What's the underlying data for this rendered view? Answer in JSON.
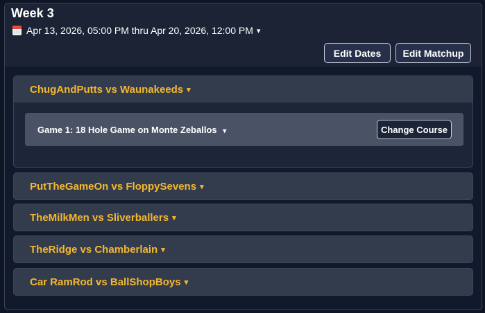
{
  "header": {
    "title": "Week 3",
    "date_range": "Apr 13, 2026, 05:00 PM thru Apr 20, 2026, 12:00 PM",
    "date_caret": "▾",
    "edit_dates_label": "Edit Dates",
    "edit_matchup_label": "Edit Matchup"
  },
  "matches": [
    {
      "label": "ChugAndPutts vs Waunakeeds",
      "caret": "▾",
      "expanded": true,
      "game": {
        "label": "Game 1: 18 Hole Game on Monte Zeballos",
        "caret": "▾",
        "change_course_label": "Change Course"
      }
    },
    {
      "label": "PutTheGameOn vs FloppySevens",
      "caret": "▾",
      "expanded": false
    },
    {
      "label": "TheMilkMen vs Sliverballers",
      "caret": "▾",
      "expanded": false
    },
    {
      "label": "TheRidge vs Chamberlain",
      "caret": "▾",
      "expanded": false
    },
    {
      "label": "Car RamRod vs BallShopBoys",
      "caret": "▾",
      "expanded": false
    }
  ],
  "colors": {
    "accent": "#f5b82e",
    "background": "#111a2c",
    "match_row": "#333c4d",
    "game_row": "#4a5366"
  },
  "icons": {
    "date": "calendar-icon",
    "expand": "chevron-down-icon"
  }
}
